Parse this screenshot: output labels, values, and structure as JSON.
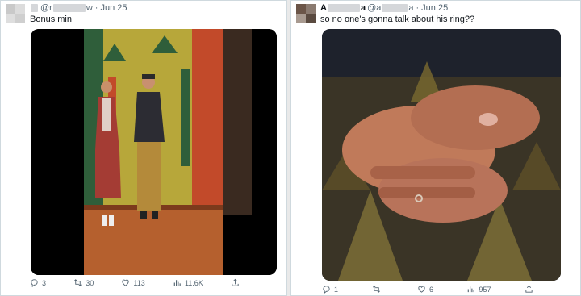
{
  "tweets": [
    {
      "handle_start": "@r",
      "handle_end": "w",
      "separator": "·",
      "date": "Jun 25",
      "text": "Bonus min",
      "stats": {
        "replies": "3",
        "retweets": "30",
        "likes": "113",
        "views": "11.6K"
      }
    },
    {
      "name_initial": "A",
      "name_end": "a",
      "handle_start": "@a",
      "handle_end": "a",
      "separator": "·",
      "date": "Jun 25",
      "text": "so no one's gonna talk about his ring??",
      "stats": {
        "replies": "1",
        "retweets": "",
        "likes": "6",
        "views": "957"
      }
    }
  ],
  "icons": [
    "reply-icon",
    "retweet-icon",
    "like-icon",
    "views-icon",
    "share-icon"
  ]
}
